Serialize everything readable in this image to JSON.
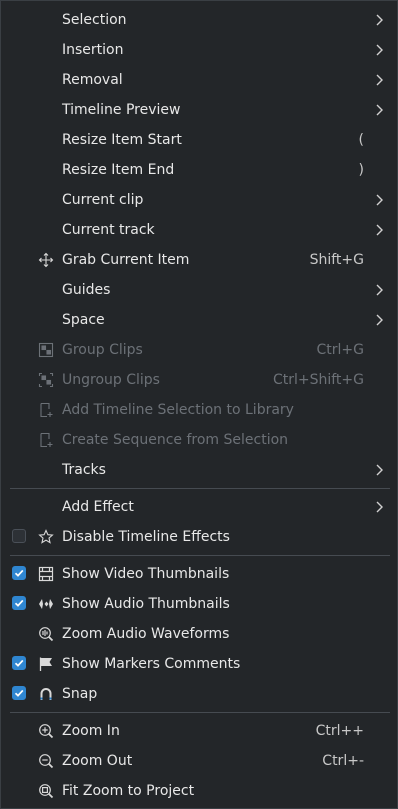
{
  "menu": {
    "selection": "Selection",
    "insertion": "Insertion",
    "removal": "Removal",
    "timeline_preview": "Timeline Preview",
    "resize_item_start": "Resize Item Start",
    "resize_item_start_shortcut": "(",
    "resize_item_end": "Resize Item End",
    "resize_item_end_shortcut": ")",
    "current_clip": "Current clip",
    "current_track": "Current track",
    "grab_current_item": "Grab Current Item",
    "grab_current_item_shortcut": "Shift+G",
    "guides": "Guides",
    "space": "Space",
    "group_clips": "Group Clips",
    "group_clips_shortcut": "Ctrl+G",
    "ungroup_clips": "Ungroup Clips",
    "ungroup_clips_shortcut": "Ctrl+Shift+G",
    "add_timeline_selection_to_library": "Add Timeline Selection to Library",
    "create_sequence_from_selection": "Create Sequence from Selection",
    "tracks": "Tracks",
    "add_effect": "Add Effect",
    "disable_timeline_effects": "Disable Timeline Effects",
    "show_video_thumbnails": "Show Video Thumbnails",
    "show_audio_thumbnails": "Show Audio Thumbnails",
    "zoom_audio_waveforms": "Zoom Audio Waveforms",
    "show_markers_comments": "Show Markers Comments",
    "snap": "Snap",
    "zoom_in": "Zoom In",
    "zoom_in_shortcut": "Ctrl++",
    "zoom_out": "Zoom Out",
    "zoom_out_shortcut": "Ctrl+-",
    "fit_zoom_to_project": "Fit Zoom to Project"
  },
  "state": {
    "disable_timeline_effects_checked": false,
    "show_video_thumbnails_checked": true,
    "show_audio_thumbnails_checked": true,
    "show_markers_comments_checked": true,
    "snap_checked": true,
    "group_clips_enabled": false,
    "ungroup_clips_enabled": false,
    "add_timeline_selection_to_library_enabled": false,
    "create_sequence_from_selection_enabled": false
  },
  "icons": {
    "grab_current_item": "move-arrows-icon",
    "group_clips": "group-icon",
    "ungroup_clips": "ungroup-icon",
    "add_timeline_selection_to_library": "library-add-icon",
    "create_sequence_from_selection": "sequence-add-icon",
    "disable_timeline_effects": "star-icon",
    "show_video_thumbnails": "film-icon",
    "show_audio_thumbnails": "audio-waveform-icon",
    "zoom_audio_waveforms": "zoom-waveform-icon",
    "show_markers_comments": "flag-icon",
    "snap": "magnet-icon",
    "zoom_in": "zoom-in-icon",
    "zoom_out": "zoom-out-icon",
    "fit_zoom_to_project": "zoom-fit-icon"
  },
  "colors": {
    "background": "#232629",
    "text": "#e8e8e8",
    "disabled_text": "#6c7177",
    "checkbox_accent": "#2f86d1",
    "separator": "#464b51"
  }
}
